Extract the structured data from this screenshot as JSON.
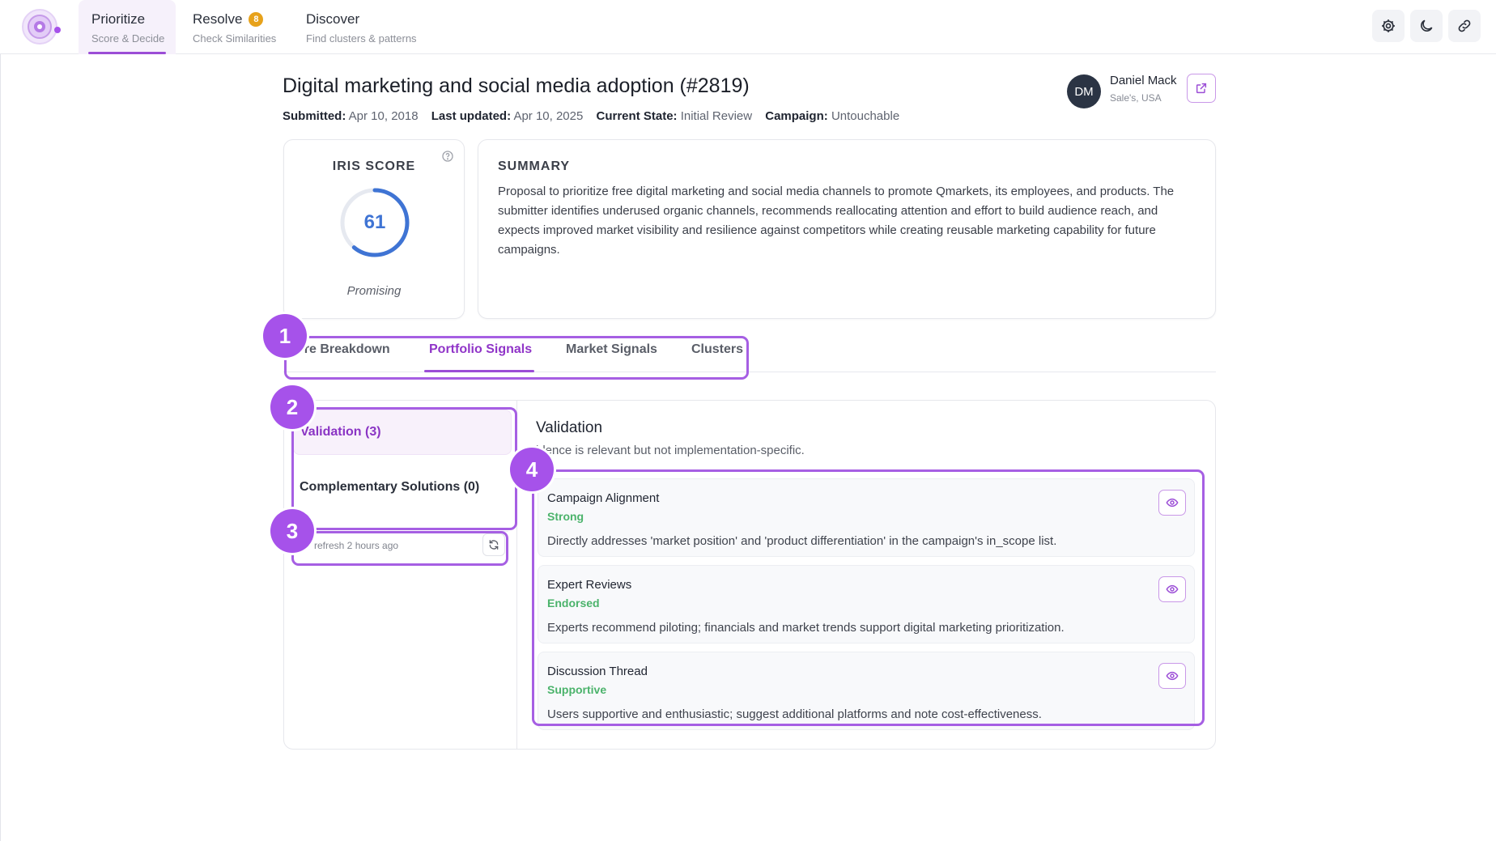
{
  "nav": {
    "tabs": [
      {
        "title": "Prioritize",
        "subtitle": "Score & Decide"
      },
      {
        "title": "Resolve",
        "subtitle": "Check Similarities",
        "badge": "8"
      },
      {
        "title": "Discover",
        "subtitle": "Find clusters & patterns"
      }
    ],
    "icons": [
      "gear-icon",
      "moon-icon",
      "link-icon"
    ]
  },
  "idea": {
    "title": "Digital marketing and social media adoption (#2819)",
    "submitted_label": "Submitted:",
    "submitted": "Apr 10, 2018",
    "updated_label": "Last updated:",
    "updated": "Apr 10, 2025",
    "state_label": "Current State:",
    "state": "Initial Review",
    "campaign_label": "Campaign:",
    "campaign": "Untouchable"
  },
  "user": {
    "initials": "DM",
    "name": "Daniel Mack",
    "location": "Sale's, USA"
  },
  "score": {
    "label": "IRIS SCORE",
    "value": "61",
    "fraction": 0.61,
    "verdict": "Promising"
  },
  "summary": {
    "heading": "SUMMARY",
    "text": "Proposal to prioritize free digital marketing and social media channels to promote Qmarkets, its employees, and products. The submitter identifies underused organic channels, recommends reallocating attention and effort to build audience reach, and expects improved market visibility and resilience against competitors while creating reusable marketing capability for future campaigns."
  },
  "tabs": [
    "ore Breakdown",
    "Portfolio Signals",
    "Market Signals",
    "Clusters"
  ],
  "sidenav": {
    "items": [
      "Validation (3)",
      "Complementary Solutions (0)"
    ],
    "refresh": "refresh 2 hours ago"
  },
  "validation": {
    "title": "Validation",
    "subtitle": "idence is relevant but not implementation-specific.",
    "signals": [
      {
        "name": "Campaign Alignment",
        "status": "Strong",
        "desc": "Directly addresses 'market position' and 'product differentiation' in the campaign's in_scope list."
      },
      {
        "name": "Expert Reviews",
        "status": "Endorsed",
        "desc": "Experts recommend piloting; financials and market trends support digital marketing prioritization."
      },
      {
        "name": "Discussion Thread",
        "status": "Supportive",
        "desc": "Users supportive and enthusiastic; suggest additional platforms and note cost-effectiveness."
      }
    ]
  },
  "markers": [
    "1",
    "2",
    "3",
    "4"
  ],
  "colors": {
    "accent": "#9b4dd6",
    "score_blue": "#3f74d4",
    "positive": "#4bb36b",
    "badge": "#e7a21b",
    "marker": "#a652ea"
  }
}
